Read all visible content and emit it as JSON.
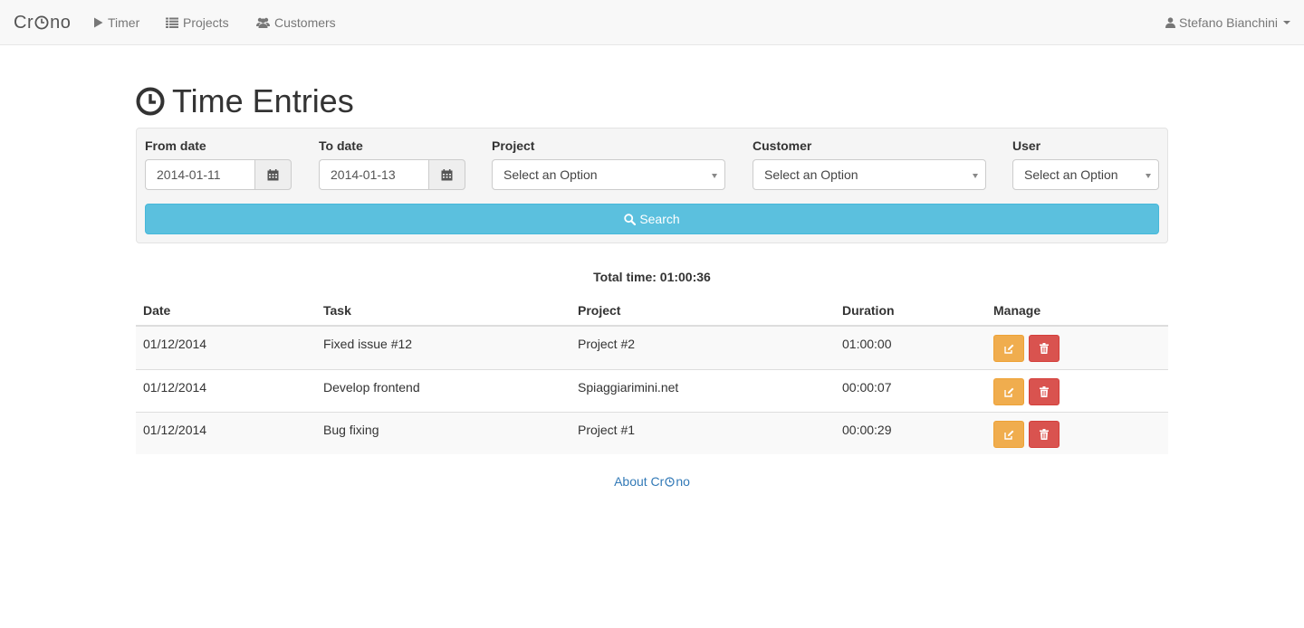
{
  "navbar": {
    "brand": {
      "prefix": "Cr",
      "suffix": "no"
    },
    "items": [
      {
        "label": "Timer",
        "icon": "play-icon"
      },
      {
        "label": "Projects",
        "icon": "list-icon"
      },
      {
        "label": "Customers",
        "icon": "users-icon"
      }
    ],
    "user": {
      "name": "Stefano Bianchini",
      "icon": "user-icon"
    }
  },
  "page": {
    "title": "Time Entries",
    "icon": "clock-icon"
  },
  "filters": {
    "from_date": {
      "label": "From date",
      "value": "2014-01-11"
    },
    "to_date": {
      "label": "To date",
      "value": "2014-01-13"
    },
    "project": {
      "label": "Project",
      "value": "Select an Option"
    },
    "customer": {
      "label": "Customer",
      "value": "Select an Option"
    },
    "user": {
      "label": "User",
      "value": "Select an Option"
    },
    "search_label": "Search"
  },
  "total": {
    "text": "Total time: 01:00:36"
  },
  "table": {
    "headers": {
      "date": "Date",
      "task": "Task",
      "project": "Project",
      "duration": "Duration",
      "manage": "Manage"
    },
    "rows": [
      {
        "date": "01/12/2014",
        "task": "Fixed issue #12",
        "project": "Project #2",
        "duration": "01:00:00"
      },
      {
        "date": "01/12/2014",
        "task": "Develop frontend",
        "project": "Spiaggiarimini.net",
        "duration": "00:00:07"
      },
      {
        "date": "01/12/2014",
        "task": "Bug fixing",
        "project": "Project #1",
        "duration": "00:00:29"
      }
    ]
  },
  "footer": {
    "prefix": "About Cr",
    "suffix": "no"
  },
  "colors": {
    "info": "#5bc0de",
    "warning": "#f0ad4e",
    "danger": "#d9534f",
    "link": "#337ab7"
  }
}
